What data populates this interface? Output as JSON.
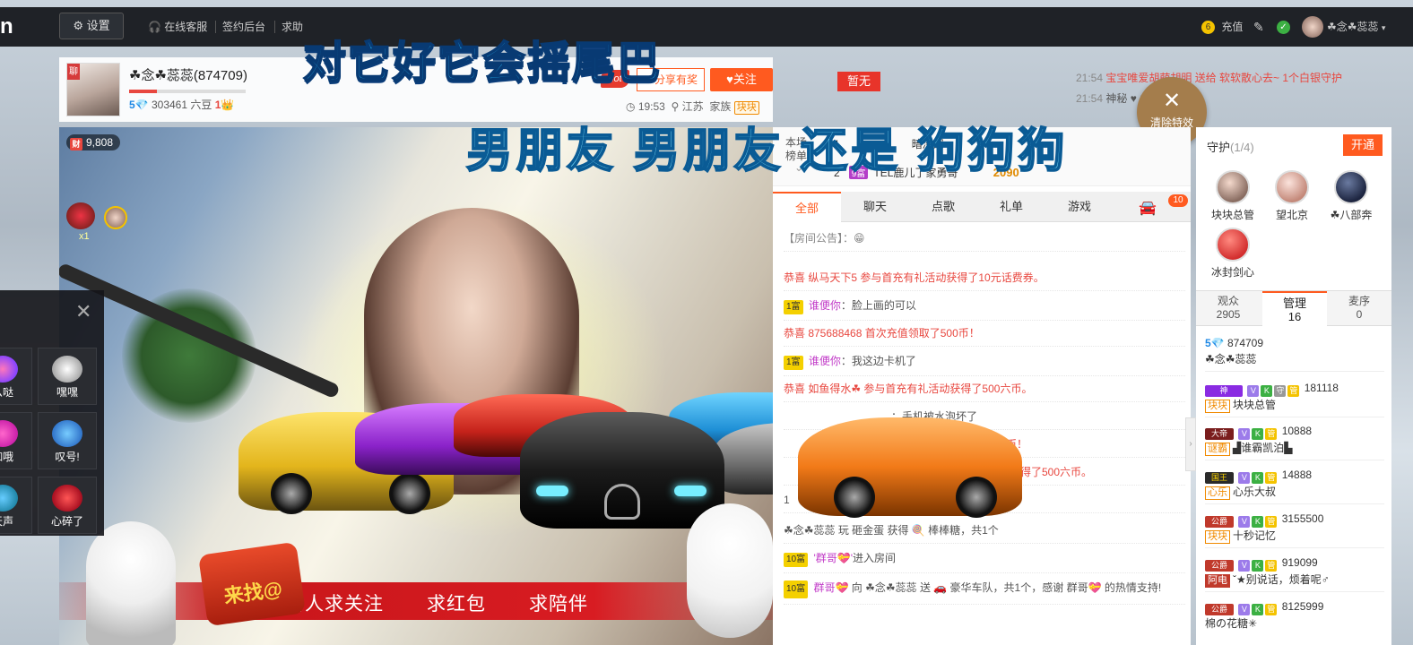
{
  "topbar": {
    "logo": "n",
    "settings": "设置",
    "nav": [
      "在线客服",
      "签约后台",
      "求助"
    ],
    "recharge_count": "6",
    "recharge": "充值",
    "username": "☘念☘蕊蕊"
  },
  "anchor": {
    "avatar_tag": "聊",
    "name": "☘念☘蕊蕊(874709)",
    "level": "5💎",
    "beans": "303461 六豆",
    "fans_level": "1👑",
    "hot": "hot",
    "share": "分享有奖",
    "follow": "♥关注",
    "time": "19:53",
    "location": "江苏",
    "family_label": "家族",
    "family_tag": "块块"
  },
  "overlay": {
    "headline": "对它好它会摇尾巴",
    "subline": "男朋友 男朋友 还是 狗狗狗"
  },
  "video": {
    "rich_tag": "财",
    "rich_value": "9,808",
    "combo": "x1",
    "banner": [
      "新人求关注",
      "求红包",
      "求陪伴"
    ],
    "sign_text": "来找@"
  },
  "gift_panel": {
    "close": "✕",
    "items": [
      {
        "label": "么哒"
      },
      {
        "label": "嘿嘿"
      },
      {
        "label": "咖哦"
      },
      {
        "label": "叹号!"
      },
      {
        "label": "天声"
      },
      {
        "label": "心碎了"
      }
    ]
  },
  "pk": {
    "label": "暂无",
    "rank_title": "本场\n榜单",
    "rows": [
      {
        "rank": "1",
        "name": "暗深深",
        "score": ""
      },
      {
        "rank": "2",
        "tag": "9富",
        "name": "TEL鹿儿了家勇哥",
        "score": "2090"
      }
    ]
  },
  "chat": {
    "tabs": [
      "全部",
      "聊天",
      "点歌",
      "礼单",
      "游戏"
    ],
    "tab_count": "10",
    "messages": [
      {
        "text": "【房间公告】：😁",
        "type": "notice"
      },
      {
        "text": "恭喜 纵马天下5 参与首充有礼活动获得了10元话费券。",
        "type": "sys"
      },
      {
        "tag": "1富",
        "user": "谁便你",
        "text": "：脸上画的可以",
        "type": "chat"
      },
      {
        "text": "恭喜 875688468 首次充值领取了500币！",
        "type": "sys"
      },
      {
        "tag": "1富",
        "user": "谁便你",
        "text": "：我这边卡机了",
        "type": "chat"
      },
      {
        "text": "恭喜 如鱼得水☘ 参与首充有礼活动获得了500六币。",
        "type": "sys"
      },
      {
        "text": "：手机被水泡坏了",
        "type": "chat"
      },
      {
        "text": "000币！",
        "type": "sys"
      },
      {
        "text": "活动获得了500六币。",
        "type": "sys"
      },
      {
        "text": "1",
        "type": "chat"
      },
      {
        "text": "☘念☘蕊蕊 玩 砸金蛋 获得 🍭 棒棒糖，共1个",
        "type": "game"
      },
      {
        "tag": "10富",
        "user": "'群哥💝'",
        "text": "进入房间",
        "type": "enter"
      },
      {
        "tag": "10富",
        "user": "群哥💝",
        "text": "向 ☘念☘蕊蕊 送 🚗 豪华车队，共1个，感谢 群哥💝 的热情支持!",
        "type": "gift"
      }
    ]
  },
  "feed": [
    {
      "time": "21:54",
      "text": "宝宝唯爱胡萌胡明 送给 软软散心去~ 1个白银守护"
    },
    {
      "time": "21:54",
      "text": "神秘 ♥ 1个爱的火山"
    }
  ],
  "clear_fx": {
    "icon": "✕",
    "label": "清除特效"
  },
  "guard": {
    "title": "守护",
    "count": "(1/4)",
    "open": "开通",
    "members": [
      "块块总管",
      "望北京",
      "☘八部奔",
      "冰封剑心"
    ]
  },
  "right_tabs": [
    {
      "label": "观众",
      "count": "2905"
    },
    {
      "label": "管理",
      "count": "16"
    },
    {
      "label": "麦序",
      "count": "0"
    }
  ],
  "admins": [
    {
      "tag": "5💎",
      "id": "874709",
      "name": "☘念☘蕊蕊"
    },
    {
      "tag": "神",
      "id": "181118",
      "fam": "块块",
      "name": "块块总管"
    },
    {
      "tag": "大帝",
      "id": "10888",
      "fam": "谜霸",
      "name": "▟谁霸凯泊▙"
    },
    {
      "tag": "国王",
      "id": "14888",
      "fam": "心乐",
      "name": "心乐大叔"
    },
    {
      "tag": "公爵",
      "id": "3155500",
      "fam": "块块",
      "name": "十秒记忆"
    },
    {
      "tag": "公爵",
      "id": "919099",
      "fam": "阿电",
      "name": "ˇ★别说话，烦着呢♂"
    },
    {
      "tag": "公爵",
      "id": "8125999",
      "name": "棉の花糖✳"
    }
  ],
  "colors": {
    "accent": "#ff5a1f",
    "topbar": "#1f2227",
    "headline": "#20a8e6"
  }
}
